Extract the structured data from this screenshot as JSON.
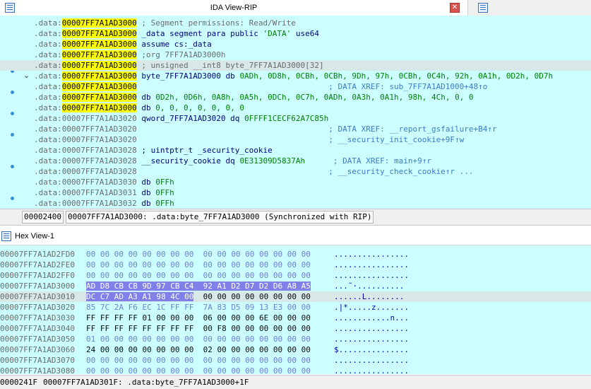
{
  "ida_view": {
    "title": "IDA View-RIP",
    "close_label": "✕",
    "lines": [
      {
        "seg": ".data:",
        "addr": "00007FF7A1AD3000",
        "addr_hl": true,
        "parts": [
          {
            "t": " ; Segment permissions: Read/Write",
            "c": "cmt"
          }
        ]
      },
      {
        "seg": ".data:",
        "addr": "00007FF7A1AD3000",
        "addr_hl": true,
        "parts": [
          {
            "t": " _data segment para public ",
            "c": "kw"
          },
          {
            "t": "'DATA'",
            "c": "str"
          },
          {
            "t": " use64",
            "c": "kw"
          }
        ]
      },
      {
        "seg": ".data:",
        "addr": "00007FF7A1AD3000",
        "addr_hl": true,
        "parts": [
          {
            "t": " assume cs:",
            "c": "kw"
          },
          {
            "t": "_data",
            "c": "kw"
          }
        ]
      },
      {
        "seg": ".data:",
        "addr": "00007FF7A1AD3000",
        "addr_hl": true,
        "parts": [
          {
            "t": " ;org 7FF7A1AD3000h",
            "c": "cmt"
          }
        ]
      },
      {
        "seg": ".data:",
        "addr": "00007FF7A1AD3000",
        "addr_hl": true,
        "cur": true,
        "parts": [
          {
            "t": " ; unsigned __int8 byte_7FF7A1AD3000[32]",
            "c": "cmt"
          }
        ]
      },
      {
        "seg": ".data:",
        "addr": "00007FF7A1AD3000",
        "addr_hl": true,
        "parts": [
          {
            "t": " byte_7FF7A1AD3000",
            "c": "name"
          },
          {
            "t": " db ",
            "c": "kw"
          },
          {
            "t": "0ADh, 0D8h, 0CBh, 0CBh, 9Dh, 97h, 0CBh, 0C4h, 92h, 0A1h, 0D2h, 0D7h",
            "c": "num"
          }
        ]
      },
      {
        "seg": ".data:",
        "addr": "00007FF7A1AD3000",
        "addr_hl": true,
        "parts": [
          {
            "t": "                                         ; DATA XREF: sub_7FF7A1AD1000+48↑o",
            "c": "xref"
          }
        ]
      },
      {
        "seg": ".data:",
        "addr": "00007FF7A1AD3000",
        "addr_hl": true,
        "parts": [
          {
            "t": " db ",
            "c": "kw"
          },
          {
            "t": "0D2h, 0D6h, 0A8h, 0A5h, 0DCh, 0C7h, 0ADh, 0A3h, 0A1h, 98h, 4Ch, 0, 0",
            "c": "num"
          }
        ]
      },
      {
        "seg": ".data:",
        "addr": "00007FF7A1AD3000",
        "addr_hl": true,
        "parts": [
          {
            "t": " db ",
            "c": "kw"
          },
          {
            "t": "0, 0, 0, 0, 0, 0, 0",
            "c": "num"
          }
        ]
      },
      {
        "seg": ".data:",
        "addr": "00007FF7A1AD3020",
        "addr_hl": false,
        "parts": [
          {
            "t": " qword_7FF7A1AD3020",
            "c": "name"
          },
          {
            "t": " dq ",
            "c": "kw"
          },
          {
            "t": "0FFFF1CECF62A7C85h",
            "c": "num"
          }
        ]
      },
      {
        "seg": ".data:",
        "addr": "00007FF7A1AD3020",
        "addr_hl": false,
        "parts": [
          {
            "t": "                                         ; DATA XREF: __report_gsfailure+B4↑r",
            "c": "xref"
          }
        ]
      },
      {
        "seg": ".data:",
        "addr": "00007FF7A1AD3020",
        "addr_hl": false,
        "parts": [
          {
            "t": "                                         ; __security_init_cookie+9F↑w",
            "c": "xref"
          }
        ]
      },
      {
        "seg": ".data:",
        "addr": "00007FF7A1AD3028",
        "addr_hl": false,
        "parts": [
          {
            "t": " ; uintptr_t _security_cookie",
            "c": "kw"
          }
        ]
      },
      {
        "seg": ".data:",
        "addr": "00007FF7A1AD3028",
        "addr_hl": false,
        "parts": [
          {
            "t": " __security_cookie",
            "c": "name"
          },
          {
            "t": " dq ",
            "c": "kw"
          },
          {
            "t": "0E31309D5837Ah",
            "c": "num"
          },
          {
            "t": "      ; DATA XREF: main+9↑r",
            "c": "xref"
          }
        ]
      },
      {
        "seg": ".data:",
        "addr": "00007FF7A1AD3028",
        "addr_hl": false,
        "parts": [
          {
            "t": "                                         ; __security_check_cookie↑r ...",
            "c": "xref"
          }
        ]
      },
      {
        "seg": ".data:",
        "addr": "00007FF7A1AD3030",
        "addr_hl": false,
        "parts": [
          {
            "t": " db ",
            "c": "kw"
          },
          {
            "t": "0FFh",
            "c": "num"
          }
        ]
      },
      {
        "seg": ".data:",
        "addr": "00007FF7A1AD3031",
        "addr_hl": false,
        "parts": [
          {
            "t": " db ",
            "c": "kw"
          },
          {
            "t": "0FFh",
            "c": "num"
          }
        ]
      },
      {
        "seg": ".data:",
        "addr": "00007FF7A1AD3032",
        "addr_hl": false,
        "parts": [
          {
            "t": " db ",
            "c": "kw"
          },
          {
            "t": "0FFh",
            "c": "num"
          }
        ]
      }
    ],
    "status": {
      "offset": "00002400",
      "location": "00007FF7A1AD3000: .data:byte_7FF7A1AD3000",
      "sync": "(Synchronized with RIP)"
    }
  },
  "hex_view": {
    "title": "Hex View-1",
    "rows": [
      {
        "off": "00007FF7A1AD2FD0",
        "b1": "00 00 00 00 00 00 00 00",
        "b2": "00 00 00 00 00 00 00 00",
        "ascii": "................",
        "dim": true
      },
      {
        "off": "00007FF7A1AD2FE0",
        "b1": "00 00 00 00 00 00 00 00",
        "b2": "00 00 00 00 00 00 00 00",
        "ascii": "................",
        "dim": true
      },
      {
        "off": "00007FF7A1AD2FF0",
        "b1": "00 00 00 00 00 00 00 00",
        "b2": "00 00 00 00 00 00 00 00",
        "ascii": "................",
        "dim": true
      },
      {
        "off": "00007FF7A1AD3000",
        "b1": "AD D8 CB CB 9D 97 CB C4",
        "b2": "92 A1 D2 D7 D2 D6 A8 A5",
        "ascii": "...˜·..........",
        "sel": "full"
      },
      {
        "off": "00007FF7A1AD3010",
        "b1": "DC C7 AD A3 A1 98 4C 00",
        "b2": "00 00 00 00 00 00 00 00",
        "ascii": "......L........",
        "sel": "part",
        "cur": true
      },
      {
        "off": "00007FF7A1AD3020",
        "b1": "85 7C 2A F6 EC 1C FF FF",
        "b2": "7A 83 D5 09 13 E3 00 00",
        "ascii": ".|*.....z.......",
        "dim": true
      },
      {
        "off": "00007FF7A1AD3030",
        "b1": "FF FF FF FF 01 00 00 00",
        "b2": "06 00 00 00 6E 00 00 00",
        "ascii": "............n...",
        "dim": false
      },
      {
        "off": "00007FF7A1AD3040",
        "b1": "FF FF FF FF FF FF FF FF",
        "b2": "00 F8 00 00 00 00 00 00",
        "ascii": "................",
        "dim": false
      },
      {
        "off": "00007FF7A1AD3050",
        "b1": "01 00 00 00 00 00 00 00",
        "b2": "00 00 00 00 00 00 00 00",
        "ascii": "................",
        "dim": true
      },
      {
        "off": "00007FF7A1AD3060",
        "b1": "24 00 00 00 00 00 00 00",
        "b2": "02 00 00 00 00 00 00 00",
        "ascii": "$...............",
        "dim": false
      },
      {
        "off": "00007FF7A1AD3070",
        "b1": "00 00 00 00 00 00 00 00",
        "b2": "00 00 00 00 00 00 00 00",
        "ascii": "................",
        "dim": true
      },
      {
        "off": "00007FF7A1AD3080",
        "b1": "00 00 00 00 00 00 00 00",
        "b2": "00 00 00 00 00 00 00 00",
        "ascii": "................",
        "dim": true
      }
    ],
    "status": {
      "offset": "0000241F",
      "location": "00007FF7A1AD301F: .data:byte_7FF7A1AD3000+1F"
    }
  },
  "colors": {
    "view_bg": "#ccffff",
    "addr_highlight": "#ffff00",
    "selection": "#8080e8",
    "xref": "#3c7acb",
    "keyword": "#000080",
    "number": "#008000"
  },
  "icons": [
    "window-icon",
    "close-icon",
    "pane-icon",
    "breakpoint-dot-icon",
    "collapse-chevron-icon",
    "hex-view-icon"
  ]
}
